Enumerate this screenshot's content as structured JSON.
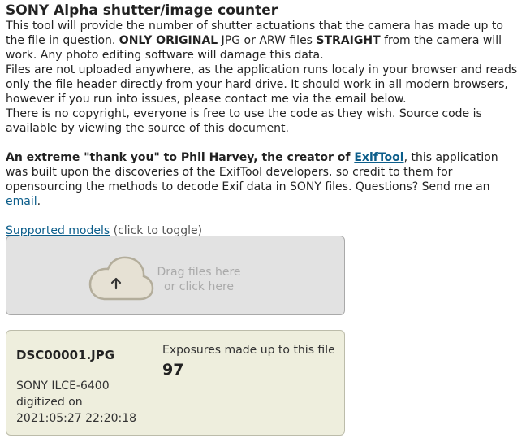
{
  "header": {
    "title": "SONY Alpha shutter/image counter"
  },
  "intro": {
    "p1_a": "This tool will provide the number of shutter actuations that the camera has made up to the file in question. ",
    "p1_b": "ONLY ORIGINAL",
    "p1_c": " JPG or ARW files ",
    "p1_d": "STRAIGHT",
    "p1_e": " from the camera will work. Any photo editing software will damage this data.",
    "p2": "Files are not uploaded anywhere, as the application runs localy in your browser and reads only the file header directly from your hard drive. It should work in all modern browsers, however if you run into issues, please contact me via the email below.",
    "p3": "There is no copyright, everyone is free to use the code as they wish. Source code is available by viewing the source of this document."
  },
  "thanks": {
    "a": "An extreme \"thank you\" to Phil Harvey, the creator of ",
    "link": "ExifTool",
    "b": ", this application was built upon the discoveries of the ExifTool developers, so credit to them for opensourcing the methods to decode Exif data in SONY files. Questions? Send me an ",
    "email_link": "email",
    "c": "."
  },
  "models": {
    "link": "Supported models",
    "hint": " (click to toggle)"
  },
  "dropzone": {
    "line1": "Drag files here",
    "line2": "or click here",
    "icon": "cloud-upload-icon"
  },
  "result": {
    "filename": "DSC00001.JPG",
    "camera": "SONY ILCE-6400",
    "digitized_label": "digitized on",
    "digitized": "2021:05:27 22:20:18",
    "exposures_label": "Exposures made up to this file",
    "exposures": "97"
  },
  "colors": {
    "link": "#0b5d8a",
    "dropzone_bg": "#e2e2e2",
    "result_bg": "#eeeedd"
  }
}
